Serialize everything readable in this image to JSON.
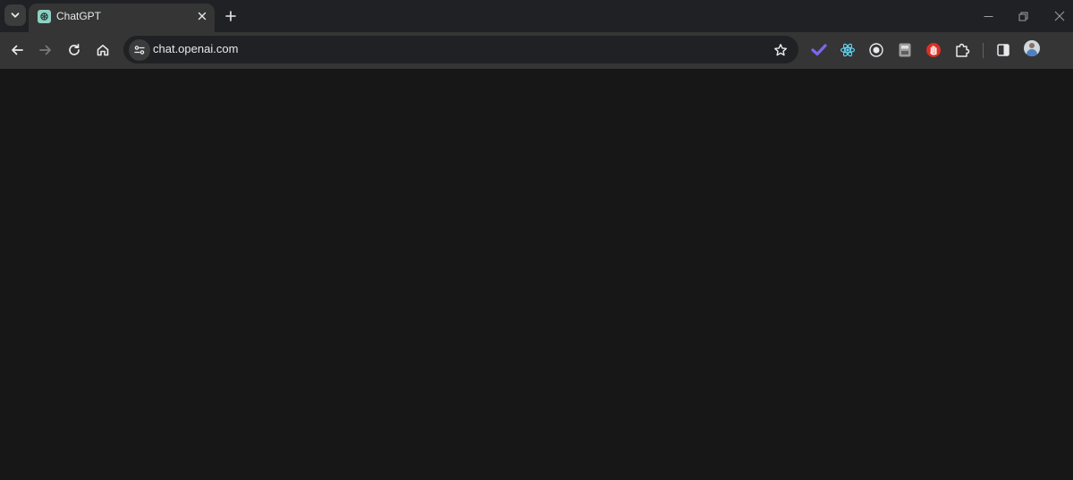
{
  "browser": {
    "tab": {
      "title": "ChatGPT",
      "favicon": "openai-icon"
    },
    "tabstrip_icons": [
      "chevron-down-icon",
      "close-icon",
      "plus-icon",
      "minimize-icon",
      "restore-icon",
      "close-window-icon"
    ],
    "toolbar": {
      "nav_icons": [
        "back-arrow-icon",
        "forward-arrow-icon",
        "reload-icon",
        "home-icon"
      ],
      "url": "chat.openai.com",
      "site_info_icon": "tune-icon",
      "bookmark_icon": "star-icon",
      "extensions": [
        "checkmark-extension-icon",
        "react-devtools-icon",
        "target-extension-icon",
        "printer-extension-icon",
        "red-hand-extension-icon",
        "puzzle-extensions-icon"
      ],
      "side_panel_icon": "side-panel-icon",
      "profile_icon": "avatar"
    }
  },
  "page": {
    "background": "#171717"
  },
  "colors": {
    "tabstrip_bg": "#202124",
    "toolbar_bg": "#353535",
    "omnibox_bg": "#202124",
    "text": "#e8eaed",
    "react_blue": "#61dafb",
    "check_purple": "#7b68ee",
    "red_extension": "#d93025"
  }
}
